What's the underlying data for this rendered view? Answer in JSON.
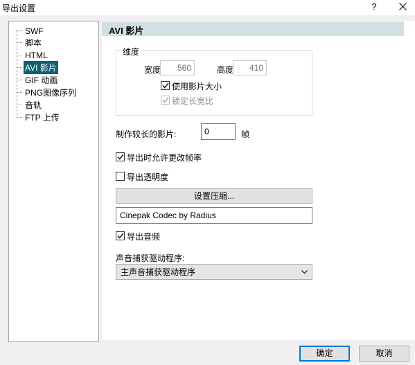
{
  "window": {
    "title": "导出设置",
    "help": "?"
  },
  "tree": {
    "items": [
      {
        "label": "SWF",
        "selected": false
      },
      {
        "label": "脚本",
        "selected": false
      },
      {
        "label": "HTML",
        "selected": false
      },
      {
        "label": "AVI 影片",
        "selected": true
      },
      {
        "label": "GIF 动画",
        "selected": false
      },
      {
        "label": "PNG图像序列",
        "selected": false
      },
      {
        "label": "音轨",
        "selected": false
      },
      {
        "label": "FTP 上传",
        "selected": false
      }
    ]
  },
  "section": {
    "title": "AVI 影片"
  },
  "dimensions": {
    "group_title": "维度",
    "width_label": "宽度:",
    "width_value": "560",
    "height_label": "高度:",
    "height_value": "410",
    "use_movie_size_label": "使用影片大小",
    "use_movie_size_checked": true,
    "lock_ratio_label": "锁定长宽比",
    "lock_ratio_checked": true
  },
  "longer_movie": {
    "label": "制作较长的影片:",
    "value": "0",
    "unit": "帧"
  },
  "allow_framerate": {
    "label": "导出时允许更改帧率",
    "checked": true
  },
  "export_transparency": {
    "label": "导出透明度",
    "checked": false
  },
  "compression": {
    "button_label": "设置压缩...",
    "codec": "Cinepak Codec by Radius"
  },
  "export_audio": {
    "label": "导出音频",
    "checked": true
  },
  "audio_driver": {
    "label": "声音捕获驱动程序:",
    "selected": "主声音捕获驱动程序"
  },
  "buttons": {
    "ok": "确定",
    "cancel": "取消"
  },
  "colors": {
    "selection": "#0f6073",
    "header_bg": "#d2e0e3",
    "window_bg": "#f0f0f0",
    "accent": "#0078d7"
  }
}
